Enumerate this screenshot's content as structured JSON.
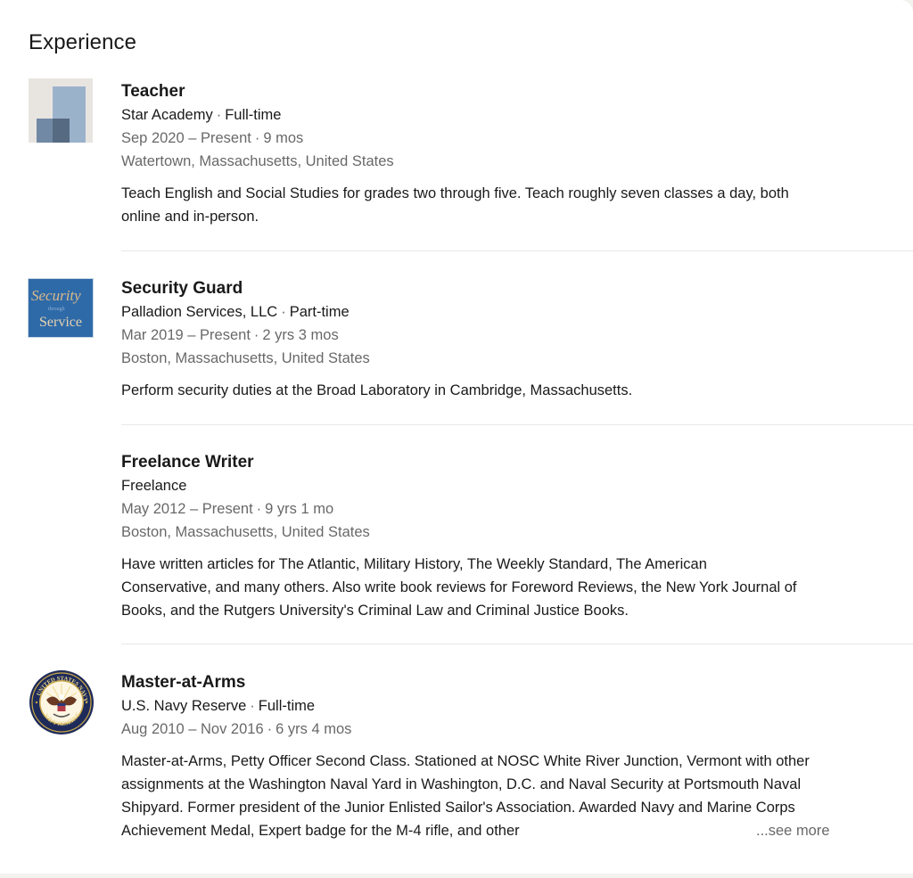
{
  "section": {
    "title": "Experience"
  },
  "experiences": [
    {
      "title": "Teacher",
      "company": "Star Academy",
      "employment_type": "Full-time",
      "date_range": "Sep 2020 – Present",
      "duration": "9 mos",
      "location": "Watertown, Massachusetts, United States",
      "description": "Teach English and Social Studies for grades two through five. Teach roughly seven classes a day, both online and in-person.",
      "logo": "star-academy-logo"
    },
    {
      "title": "Security Guard",
      "company": "Palladion Services, LLC",
      "employment_type": "Part-time",
      "date_range": "Mar 2019 – Present",
      "duration": "2 yrs 3 mos",
      "location": "Boston, Massachusetts, United States",
      "description": "Perform security duties at the Broad Laboratory in Cambridge, Massachusetts.",
      "logo": "palladion-logo",
      "logo_text": {
        "top": "Security",
        "middle": "through",
        "bottom": "Service"
      }
    },
    {
      "title": "Freelance Writer",
      "company": "Freelance",
      "date_range": "May 2012 – Present",
      "duration": "9 yrs 1 mo",
      "location": "Boston, Massachusetts, United States",
      "description": "Have written articles for The Atlantic, Military History, The Weekly Standard, The American Conservative, and many others. Also write book reviews for Foreword Reviews, the New York Journal of Books, and the Rutgers University's Criminal Law and Criminal Justice Books."
    },
    {
      "title": "Master-at-Arms",
      "company": "U.S. Navy Reserve",
      "employment_type": "Full-time",
      "date_range": "Aug 2010 – Nov 2016",
      "duration": "6 yrs 4 mos",
      "description": "Master-at-Arms, Petty Officer Second Class. Stationed at NOSC White River Junction, Vermont with other assignments at the Washington Naval Yard in Washington, D.C. and Naval Security at Portsmouth Naval Shipyard. Former president of the Junior Enlisted Sailor's Association. Awarded Navy and Marine Corps Achievement Medal, Expert badge for the M-4 rifle, and other",
      "see_more_label": "...see more",
      "logo": "us-navy-reserve-seal"
    }
  ],
  "separator": "·",
  "colors": {
    "text_primary": "#1d1d1d",
    "text_secondary": "#666666",
    "palladion_blue": "#2f6aa8",
    "palladion_gold": "#d9b98a",
    "navy_blue": "#1e2b5a",
    "navy_gold": "#c9a74a"
  }
}
